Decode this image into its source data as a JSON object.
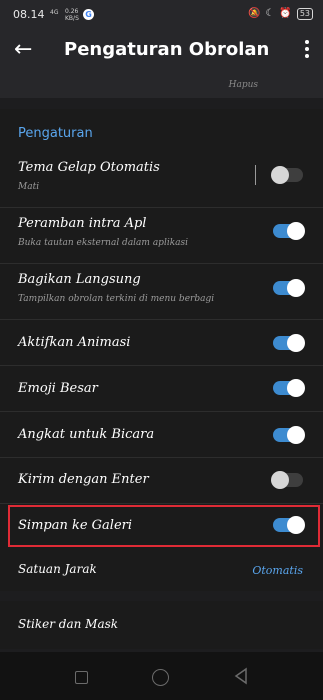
{
  "status_bar": {
    "time": "08.14",
    "sim_label": "4G",
    "net_speed": "0.26",
    "net_unit": "KB/S",
    "google_icon": "G",
    "battery": "53",
    "icons": [
      "mute-icon",
      "moon-icon",
      "alarm-icon",
      "battery-icon"
    ]
  },
  "appbar": {
    "title": "Pengaturan Obrolan",
    "back_icon": "arrow-left-icon",
    "more_icon": "more-vertical-icon"
  },
  "top": {
    "hapus": "Hapus"
  },
  "settings": {
    "section_title": "Pengaturan",
    "items": [
      {
        "label": "Tema Gelap Otomatis",
        "sub": "Mati",
        "toggle": false
      },
      {
        "label": "Peramban intra Apl",
        "sub": "Buka tautan eksternal dalam aplikasi",
        "toggle": true
      },
      {
        "label": "Bagikan Langsung",
        "sub": "Tampilkan obrolan terkini di menu berbagi",
        "toggle": true
      },
      {
        "label": "Aktifkan Animasi",
        "toggle": true
      },
      {
        "label": "Emoji Besar",
        "toggle": true
      },
      {
        "label": "Angkat untuk Bicara",
        "toggle": true
      },
      {
        "label": "Kirim dengan Enter",
        "toggle": false
      },
      {
        "label": "Simpan ke Galeri",
        "toggle": true
      }
    ],
    "distance_unit": {
      "label": "Satuan Jarak",
      "value": "Otomatis"
    }
  },
  "stickers": {
    "label": "Stiker dan Mask"
  },
  "colors": {
    "accent": "#3d8bd0",
    "link": "#5aa6ee",
    "highlight": "#e02b36",
    "background": "#1b1b1b"
  }
}
